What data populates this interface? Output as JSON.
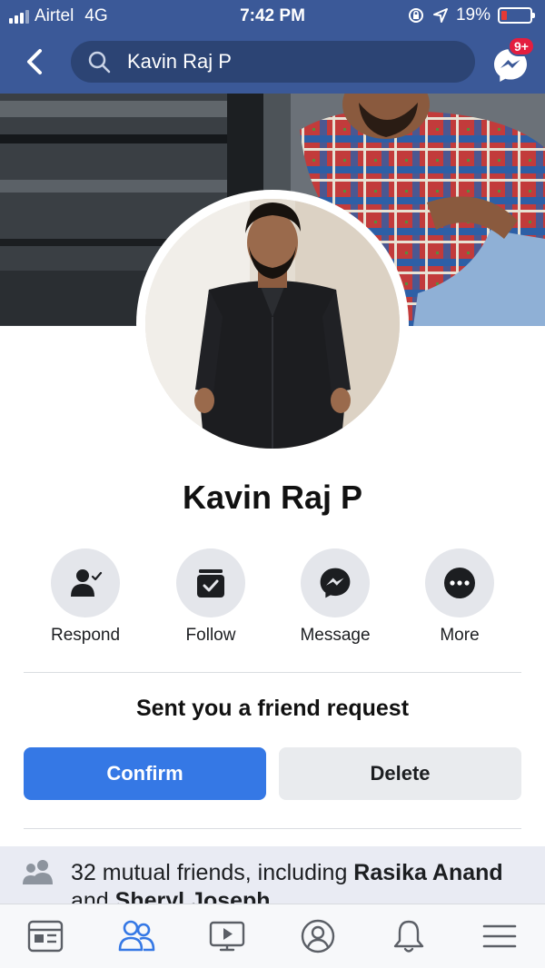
{
  "status_bar": {
    "carrier": "Airtel",
    "network": "4G",
    "time": "7:42 PM",
    "battery": "19%"
  },
  "search": {
    "query": "Kavin Raj P"
  },
  "messenger": {
    "badge": "9+"
  },
  "profile": {
    "name": "Kavin Raj P"
  },
  "actions": [
    {
      "label": "Respond",
      "icon": "respond-person-icon"
    },
    {
      "label": "Follow",
      "icon": "follow-check-icon"
    },
    {
      "label": "Message",
      "icon": "messenger-icon"
    },
    {
      "label": "More",
      "icon": "more-dots-icon"
    }
  ],
  "friend_request": {
    "title": "Sent you a friend request",
    "confirm_label": "Confirm",
    "delete_label": "Delete"
  },
  "mutual": {
    "prefix": "32 mutual friends, including ",
    "name1": "Rasika Anand",
    "and": " and ",
    "name2": "Sheryl Joseph"
  },
  "bottom_nav": [
    {
      "icon": "news-feed-icon",
      "active": false
    },
    {
      "icon": "friends-icon",
      "active": true
    },
    {
      "icon": "watch-icon",
      "active": false
    },
    {
      "icon": "profile-icon",
      "active": false
    },
    {
      "icon": "notifications-icon",
      "active": false
    },
    {
      "icon": "menu-icon",
      "active": false
    }
  ],
  "colors": {
    "header_bg": "#3b5998",
    "primary_blue": "#3578e5",
    "badge_red": "#e41e3f",
    "active_tab": "#3578e5"
  }
}
